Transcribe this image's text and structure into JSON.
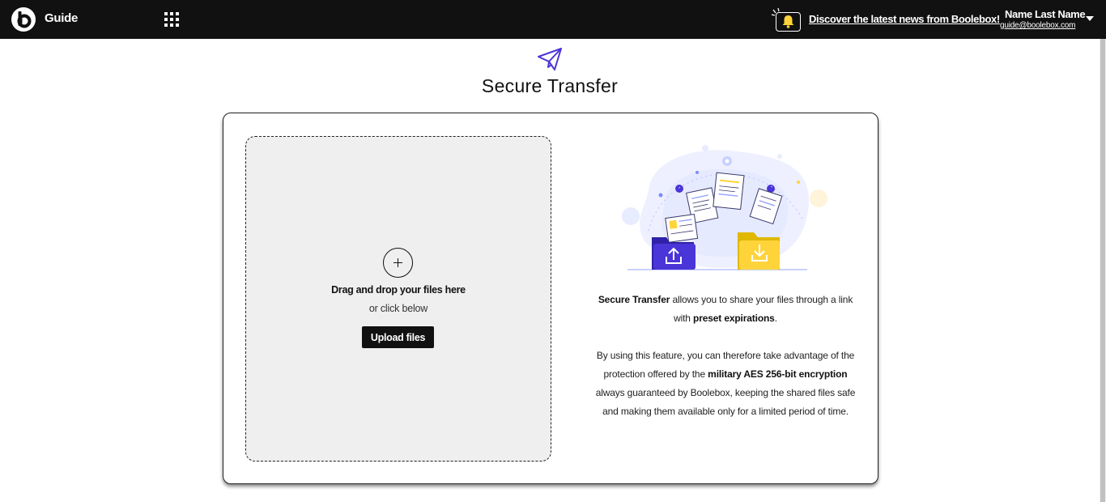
{
  "topbar": {
    "logo_icon": "boolebox-logo-icon",
    "app_name": "Guide",
    "apps_icon": "apps-grid-icon",
    "bell_icon": "bell-icon",
    "news_link": "Discover the latest news from Boolebox!",
    "user_name": "Name Last Name",
    "user_email": "guide@boolebox.com",
    "user_menu_icon": "caret-down-icon"
  },
  "page": {
    "icon": "paper-plane-icon",
    "title": "Secure Transfer"
  },
  "dropzone": {
    "icon": "plus-icon",
    "title": "Drag and drop your files here",
    "subtitle": "or click below",
    "button_label": "Upload files"
  },
  "description": {
    "p1_bold1": "Secure Transfer",
    "p1_text1": " allows you to share your files through a link with ",
    "p1_bold2": "preset expirations",
    "p1_text2": ".",
    "p2_text1": "By using this feature, you can therefore take advantage of the protection offered by the ",
    "p2_bold1": "military AES 256-bit encryption",
    "p2_text2": " always guaranteed by Boolebox, keeping the shared files safe and making them available only for a limited period of time."
  },
  "colors": {
    "topbar_bg": "#111111",
    "accent_purple": "#4a35d8",
    "accent_yellow": "#ffd43b",
    "dropzone_bg": "#efefef"
  }
}
